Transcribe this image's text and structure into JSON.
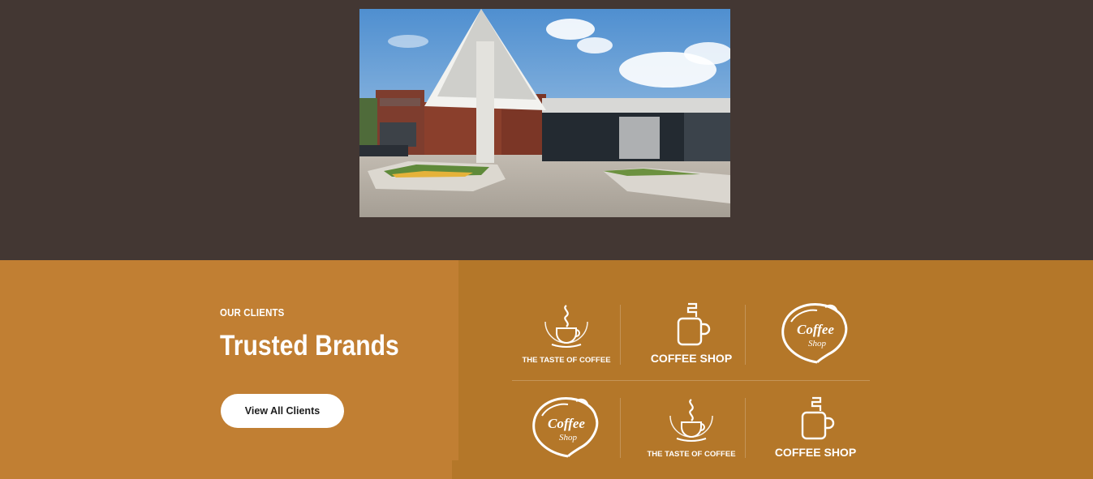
{
  "clients": {
    "eyebrow": "OUR CLIENTS",
    "heading": "Trusted Brands",
    "button_label": "View All Clients",
    "logos": [
      {
        "type": "taste-of-coffee",
        "text": "THE TASTE OF COFFEE"
      },
      {
        "type": "coffee-shop-mug",
        "text": "COFFEE SHOP"
      },
      {
        "type": "coffee-shop-script",
        "line1": "Coffee",
        "line2": "Shop"
      },
      {
        "type": "coffee-shop-script",
        "line1": "Coffee",
        "line2": "Shop"
      },
      {
        "type": "taste-of-coffee",
        "text": "THE TASTE OF COFFEE"
      },
      {
        "type": "coffee-shop-mug",
        "text": "COFFEE SHOP"
      }
    ]
  },
  "colors": {
    "top_bg": "#433733",
    "clients_left_bg": "#c17f33",
    "clients_right_bg": "#b47729",
    "text": "#ffffff"
  }
}
